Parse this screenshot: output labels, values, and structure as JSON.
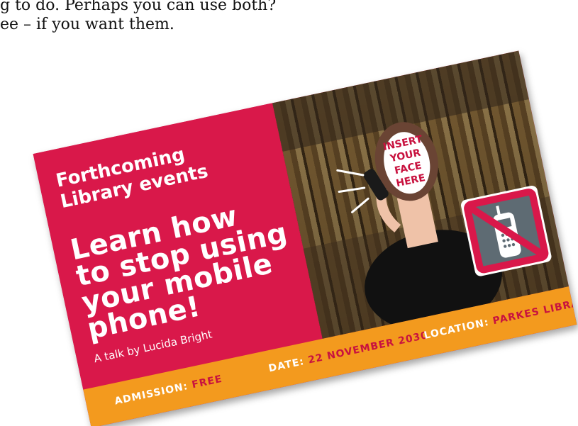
{
  "intro": {
    "line1": "g to do. Perhaps you can use both?",
    "line2": "ee – if you want them."
  },
  "card": {
    "section_title_line1": "Forthcoming",
    "section_title_line2": "Library events",
    "headline_lines": [
      "Learn how",
      "to stop using",
      "your mobile",
      "phone!"
    ],
    "byline": "A talk by Lucida Bright",
    "photo": {
      "face_placeholder_lines": [
        "INSERT",
        "YOUR",
        "FACE",
        "HERE"
      ],
      "no_phone_icon": "no-mobile-phone-icon"
    },
    "footer": {
      "admission_key": "ADMISSION:",
      "admission_value": "FREE",
      "date_key": "DATE:",
      "date_value": "22 NOVEMBER 2030",
      "location_key": "LOCATION:",
      "location_value": "PARKES LIBRARY"
    },
    "colors": {
      "brand_red": "#d9184a",
      "footer_orange": "#f39a1e",
      "accent_text_red": "#c8123f",
      "sign_gray": "#5e6b73"
    }
  }
}
